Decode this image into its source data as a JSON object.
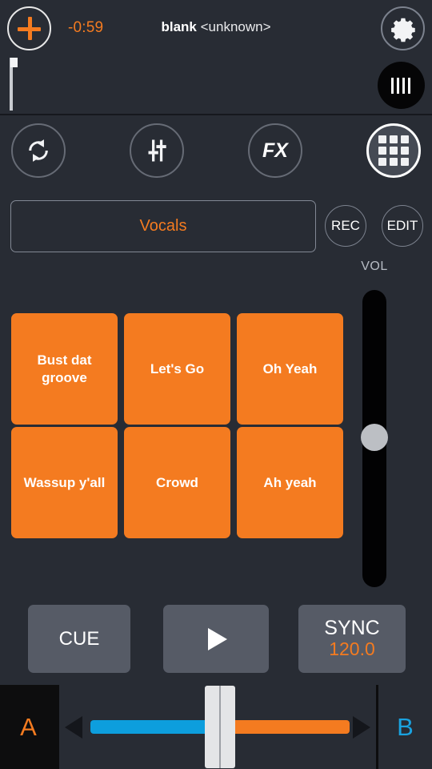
{
  "header": {
    "add_icon": "plus-icon",
    "time_remaining": "-0:59",
    "track_title": "blank",
    "track_artist": "<unknown>",
    "settings_icon": "gear-icon"
  },
  "waveform": {
    "zoom_icon": "waveform-bars-icon"
  },
  "mode_row": {
    "buttons": [
      {
        "name": "loop",
        "icon": "loop-icon",
        "label": "",
        "active": false
      },
      {
        "name": "mixer",
        "icon": "sliders-icon",
        "label": "",
        "active": false
      },
      {
        "name": "fx",
        "icon": "fx-text-icon",
        "label": "FX",
        "active": false
      },
      {
        "name": "pads",
        "icon": "grid-icon",
        "label": "",
        "active": true
      }
    ]
  },
  "bank": {
    "name": "Vocals",
    "rec_label": "REC",
    "edit_label": "EDIT"
  },
  "volume": {
    "label": "VOL",
    "value": 50
  },
  "pads": [
    {
      "label": "Bust dat groove",
      "color": "#f47b20"
    },
    {
      "label": "Let's Go",
      "color": "#f47b20"
    },
    {
      "label": "Oh Yeah",
      "color": "#f47b20"
    },
    {
      "label": "Wassup y'all",
      "color": "#f47b20"
    },
    {
      "label": "Crowd",
      "color": "#f47b20"
    },
    {
      "label": "Ah yeah",
      "color": "#f47b20"
    }
  ],
  "transport": {
    "cue_label": "CUE",
    "play_icon": "play-icon",
    "sync_label": "SYNC",
    "bpm": "120.0"
  },
  "crossfader": {
    "deck_a_label": "A",
    "deck_b_label": "B",
    "left_arrow_icon": "arrow-left-icon",
    "right_arrow_icon": "arrow-right-icon",
    "position": 50,
    "left_color": "#0d9edd",
    "right_color": "#f47b20"
  },
  "colors": {
    "accent_orange": "#f47b20",
    "accent_blue": "#0d9edd",
    "background": "#282c34",
    "button_gray": "#565b66"
  }
}
